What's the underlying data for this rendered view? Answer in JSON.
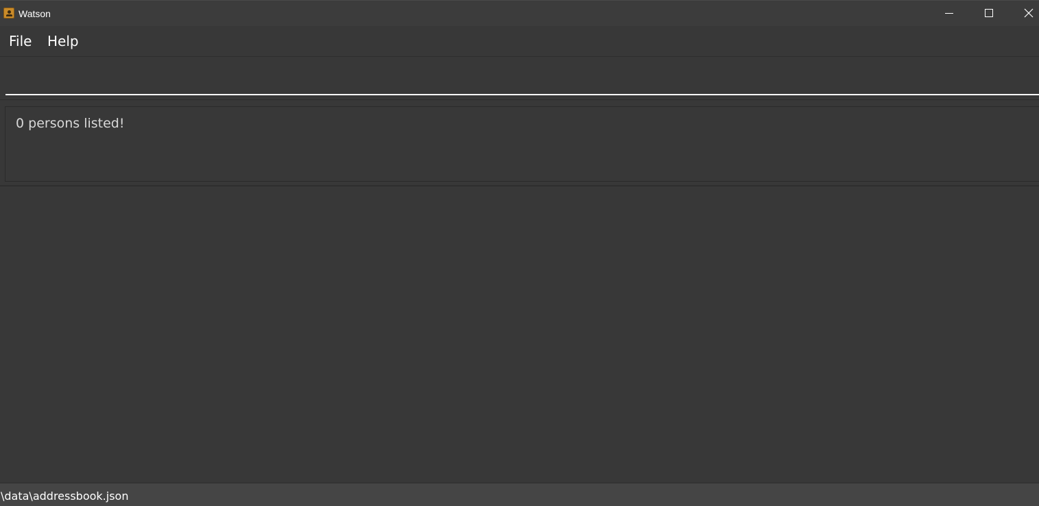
{
  "window": {
    "title": "Watson",
    "icon": "address-book-icon",
    "controls": [
      "minimize-icon",
      "maximize-icon",
      "close-icon"
    ]
  },
  "menubar": {
    "items": [
      {
        "label": "File"
      },
      {
        "label": "Help"
      }
    ]
  },
  "command": {
    "value": "",
    "placeholder": ""
  },
  "result": {
    "message": "0 persons listed!"
  },
  "person_list": {
    "items": []
  },
  "statusbar": {
    "file_path": "\\data\\addressbook.json"
  },
  "colors": {
    "background": "#383838",
    "titlebar": "#3c3c3c",
    "statusbar": "#454545",
    "text": "#ffffff",
    "result_text": "#d8d8d8",
    "icon_accent": "#c98b2a"
  }
}
